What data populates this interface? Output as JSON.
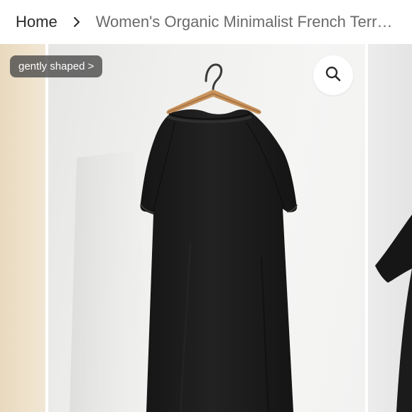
{
  "breadcrumb": {
    "home_label": "Home",
    "separator_icon": "chevron-right-icon",
    "current_label": "Women's Organic Minimalist French Terr…"
  },
  "gallery": {
    "badge_label": "gently shaped >",
    "zoom_icon": "magnifier-icon",
    "main_image": "black-short-sleeve-dress-on-wooden-hanger"
  },
  "colors": {
    "dress": "#1b1b1b",
    "hanger": "#c8935c",
    "wall": "#f2f2f1",
    "badge_bg": "#474747"
  }
}
